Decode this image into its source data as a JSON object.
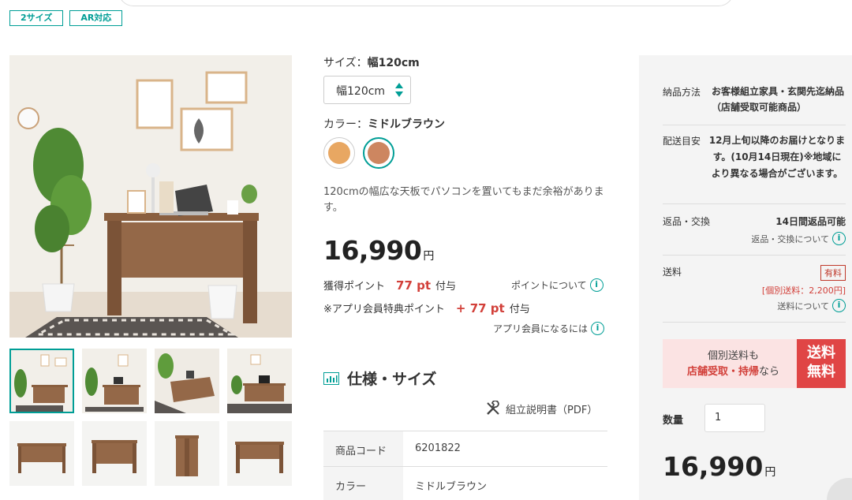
{
  "tags": [
    "2サイズ",
    "AR対応"
  ],
  "size": {
    "label": "サイズ：",
    "value": "幅120cm",
    "selected_option": "幅120cm"
  },
  "color": {
    "label": "カラー：",
    "value": "ミドルブラウン",
    "swatches": [
      {
        "name": "light",
        "color": "#e8a762"
      },
      {
        "name": "middle-brown",
        "color": "#cd8660"
      }
    ]
  },
  "description": "120cmの幅広な天板でパソコンを置いてもまだ余裕があります。",
  "price": {
    "amount": "16,990",
    "unit": "円"
  },
  "points": {
    "earned_label": "獲得ポイント",
    "earned_value": "77 pt",
    "earned_suffix": "付与",
    "about_link": "ポイントについて",
    "app_label": "※アプリ会員特典ポイント",
    "app_value": "+ 77 pt",
    "app_suffix": "付与",
    "app_link": "アプリ会員になるには"
  },
  "spec": {
    "heading": "仕様・サイズ",
    "manual_link": "組立説明書（PDF）",
    "rows": [
      {
        "key": "商品コード",
        "value": "6201822"
      },
      {
        "key": "カラー",
        "value": "ミドルブラウン"
      }
    ]
  },
  "delivery": {
    "method_label": "納品方法",
    "method_value": "お客様組立家具・玄関先迄納品（店舗受取可能商品）",
    "eta_label": "配送目安",
    "eta_value": "12月上旬以降のお届けとなります。(10月14日現在)※地域により異なる場合がございます。",
    "return_label": "返品・交換",
    "return_value": "14日間返品可能",
    "return_link": "返品・交換について",
    "shipping_label": "送料",
    "shipping_badge": "有料",
    "shipping_note": "[個別送料：2,200円]",
    "shipping_link": "送料について"
  },
  "promo": {
    "line1": "個別送料も",
    "line2_em": "店舗受取・持帰",
    "line2_tail": "なら",
    "free_1": "送料",
    "free_2": "無料"
  },
  "quantity": {
    "label": "数量",
    "value": "1"
  },
  "accent": "#009e96"
}
